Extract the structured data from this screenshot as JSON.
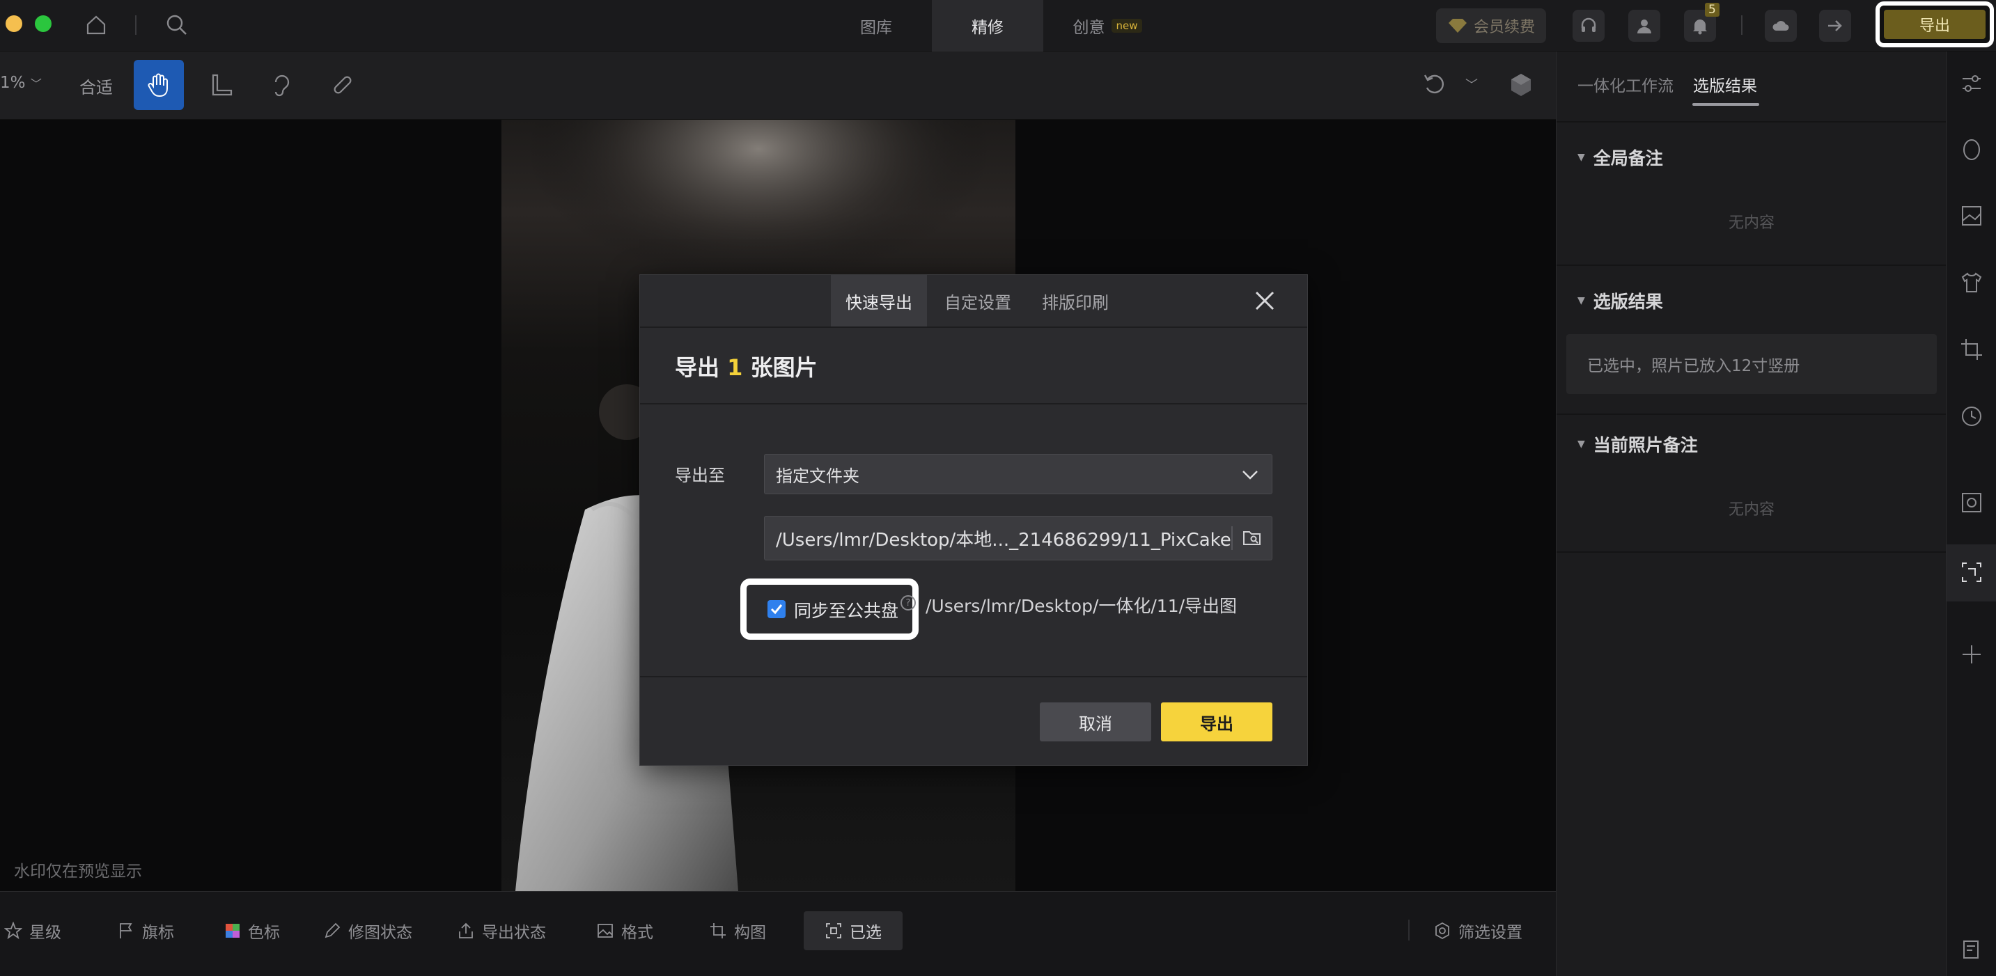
{
  "window": {
    "traffic_colors": [
      "#f5bf4f",
      "#2bc63e"
    ]
  },
  "topbar": {
    "tabs": [
      {
        "label": "图库"
      },
      {
        "label": "精修"
      },
      {
        "label": "创意"
      }
    ],
    "new_badge": "new",
    "vip_label": "会员续费",
    "notification_count": "5",
    "export_label": "导出"
  },
  "toolbar": {
    "zoom": "1%",
    "fit_label": "合适"
  },
  "canvas": {
    "watermark_note": "水印仅在预览显示"
  },
  "bottombar": {
    "items": [
      {
        "label": "星级"
      },
      {
        "label": "旗标"
      },
      {
        "label": "色标"
      },
      {
        "label": "修图状态"
      },
      {
        "label": "导出状态"
      },
      {
        "label": "格式"
      },
      {
        "label": "构图"
      },
      {
        "label": "已选"
      }
    ],
    "filter_label": "筛选设置"
  },
  "right_panel": {
    "tabs": [
      {
        "label": "一体化工作流"
      },
      {
        "label": "选版结果"
      }
    ],
    "sections": [
      {
        "title": "全局备注",
        "content": "无内容"
      },
      {
        "title": "选版结果",
        "content": "已选中，照片已放入12寸竖册"
      },
      {
        "title": "当前照片备注",
        "content": "无内容"
      }
    ]
  },
  "modal": {
    "tabs": [
      {
        "label": "快速导出"
      },
      {
        "label": "自定设置"
      },
      {
        "label": "排版印刷"
      }
    ],
    "title_prefix": "导出",
    "title_count": "1",
    "title_suffix": "张图片",
    "export_to_label": "导出至",
    "destination": "指定文件夹",
    "path": "/Users/lmr/Desktop/本地..._214686299/11_PixCake",
    "sync_label": "同步至公共盘",
    "sync_checked": true,
    "sync_path": "/Users/lmr/Desktop/一体化/11/导出图",
    "cancel_label": "取消",
    "confirm_label": "导出"
  },
  "colors": {
    "accent_yellow": "#f6d33c",
    "tool_active_blue": "#1e5ab3",
    "checkbox_blue": "#2f80ed"
  }
}
